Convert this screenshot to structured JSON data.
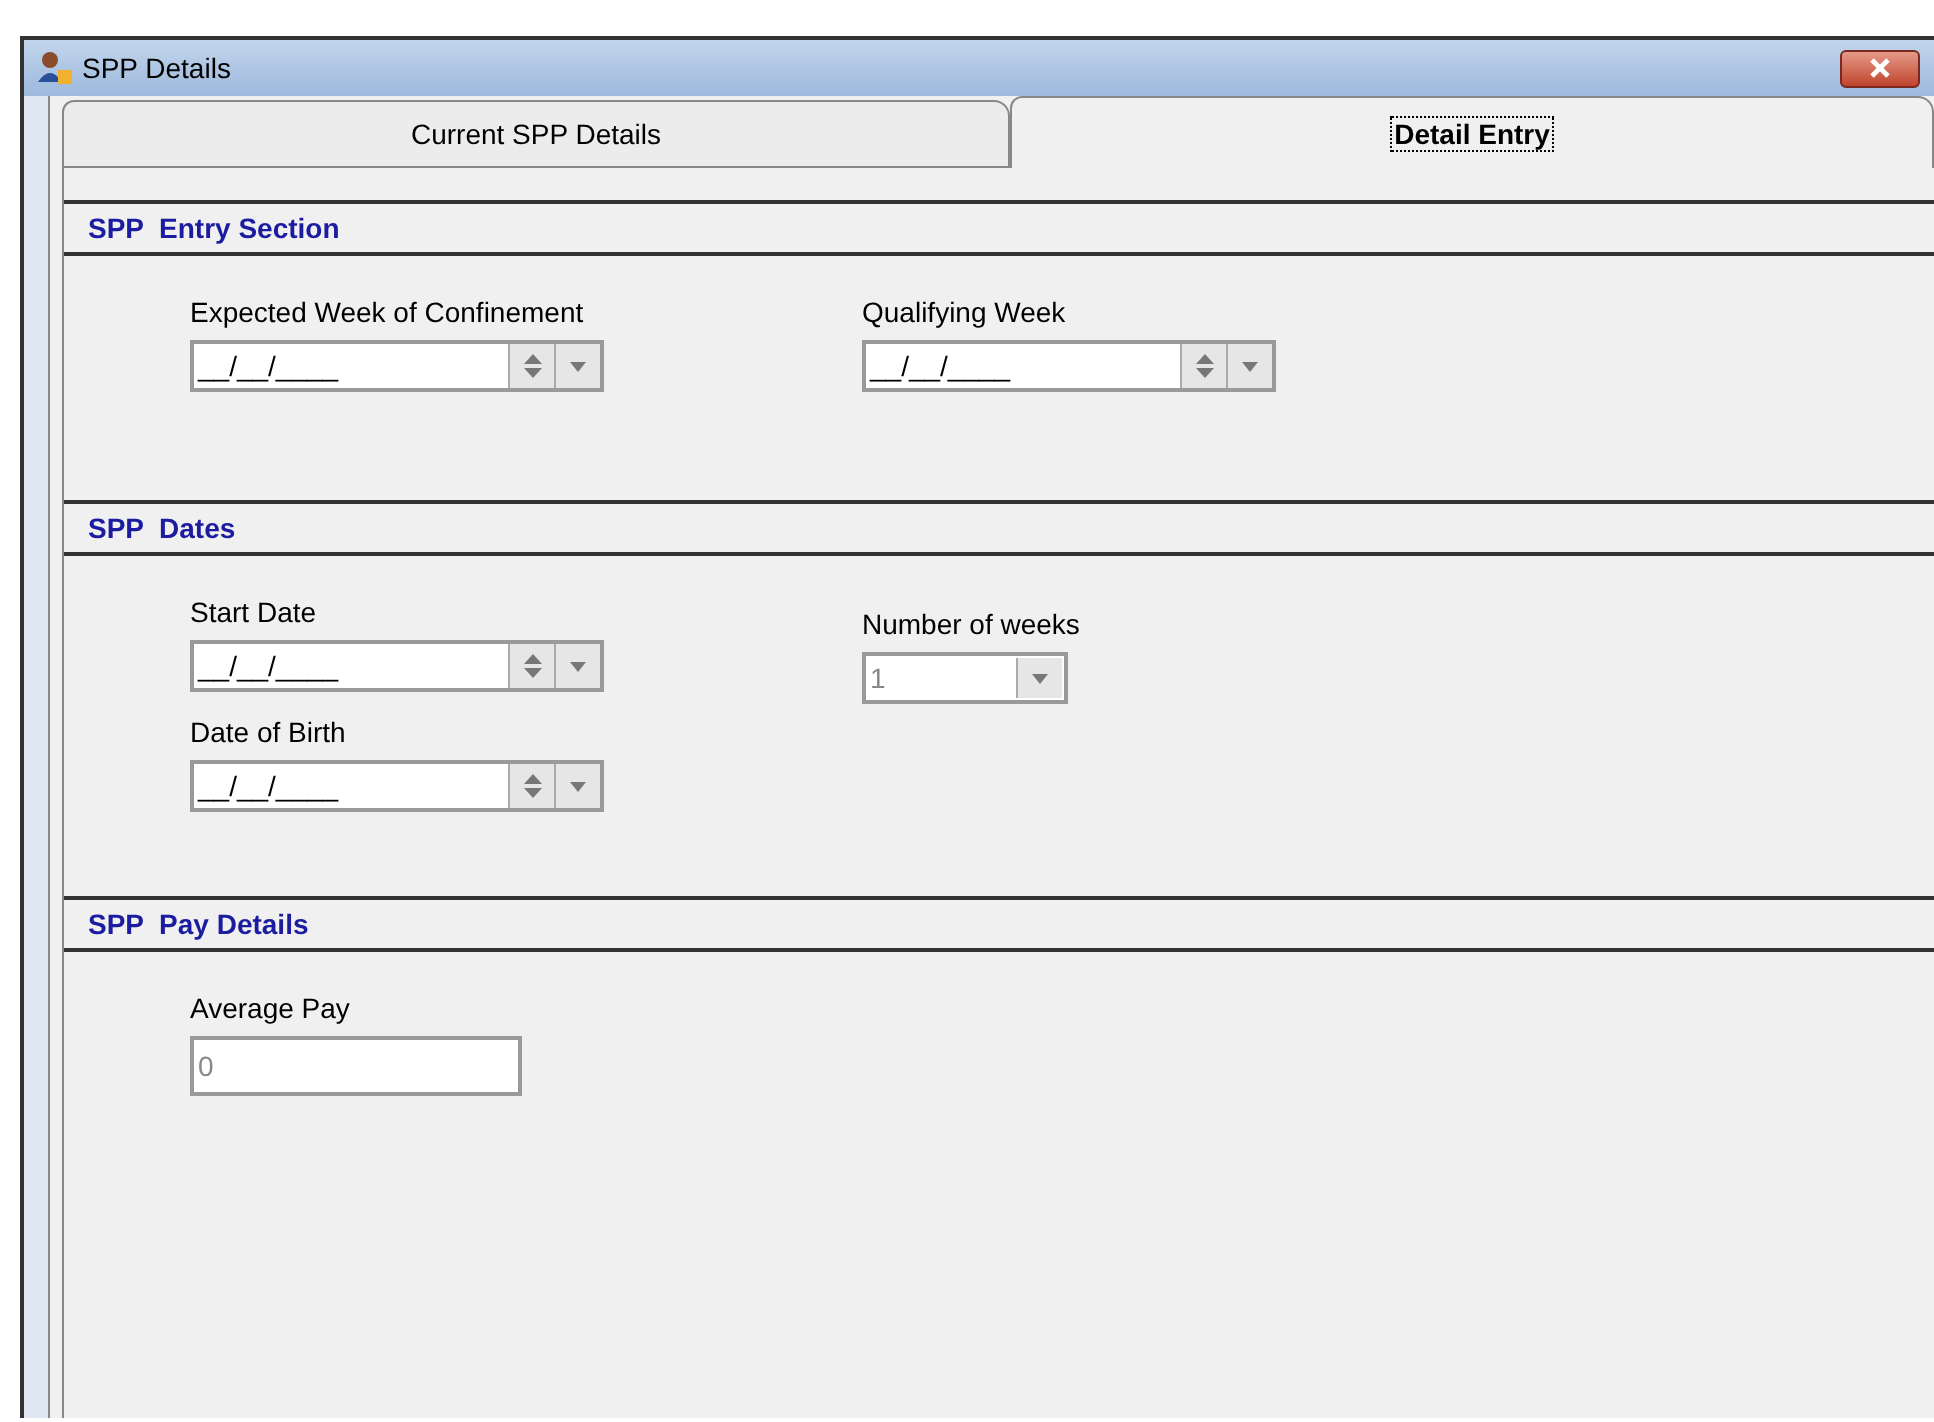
{
  "window": {
    "title": "SPP Details"
  },
  "tabs": [
    {
      "label": "Current SPP Details",
      "selected": false
    },
    {
      "label": "Detail Entry",
      "selected": true
    }
  ],
  "sections": [
    {
      "title": "SPP  Entry Section",
      "columns": [
        [
          {
            "label": "Expected Week of Confinement",
            "kind": "date",
            "value": "__/__/____",
            "disabled": false
          }
        ],
        [
          {
            "label": "Qualifying Week",
            "kind": "date",
            "value": "__/__/____",
            "disabled": false
          }
        ]
      ]
    },
    {
      "title": "SPP  Dates",
      "columns": [
        [
          {
            "label": "Start Date",
            "kind": "date",
            "value": "__/__/____",
            "disabled": false
          },
          {
            "label": "Date of Birth",
            "kind": "date",
            "value": "__/__/____",
            "disabled": false
          }
        ],
        [
          {
            "label": "Number of weeks",
            "kind": "combo",
            "value": "1",
            "disabled": true
          }
        ]
      ]
    },
    {
      "title": "SPP  Pay Details",
      "columns": [
        [
          {
            "label": "Average Pay",
            "kind": "text",
            "value": "0",
            "disabled": true
          }
        ]
      ]
    }
  ]
}
